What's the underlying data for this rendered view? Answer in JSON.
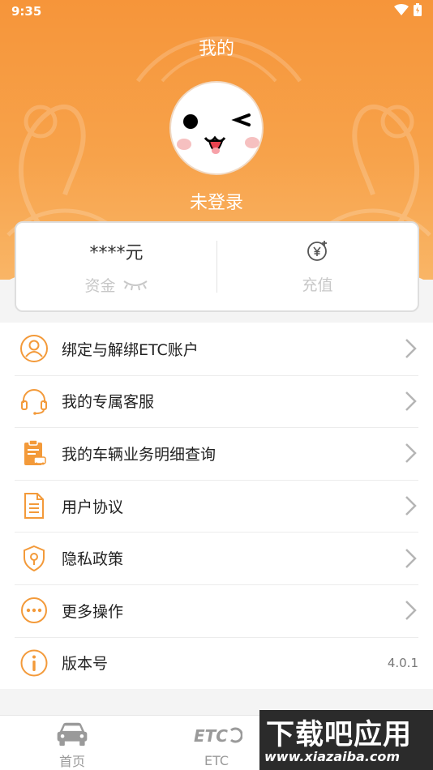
{
  "status_bar": {
    "time": "9:35"
  },
  "header": {
    "title": "我的",
    "login_status": "未登录"
  },
  "wallet": {
    "balance": "****元",
    "funds_label": "资金",
    "recharge_label": "充值"
  },
  "menu": {
    "items": [
      {
        "label": "绑定与解绑ETC账户",
        "icon": "user-icon"
      },
      {
        "label": "我的专属客服",
        "icon": "headset-icon"
      },
      {
        "label": "我的车辆业务明细查询",
        "icon": "clipboard-car-icon"
      },
      {
        "label": "用户协议",
        "icon": "document-icon"
      },
      {
        "label": "隐私政策",
        "icon": "shield-lock-icon"
      },
      {
        "label": "更多操作",
        "icon": "more-dots-icon"
      },
      {
        "label": "版本号",
        "icon": "info-icon",
        "value": "4.0.1"
      }
    ]
  },
  "tabbar": {
    "tabs": [
      {
        "label": "首页",
        "icon": "car-icon"
      },
      {
        "label": "ETC",
        "icon": "etc-logo-icon"
      }
    ]
  },
  "watermark": {
    "title": "下载吧应用",
    "url": "www.xiazaiba.com"
  },
  "colors": {
    "accent": "#f6953a",
    "icon_orange": "#f39a3a",
    "chevron": "#b5b5b5"
  }
}
